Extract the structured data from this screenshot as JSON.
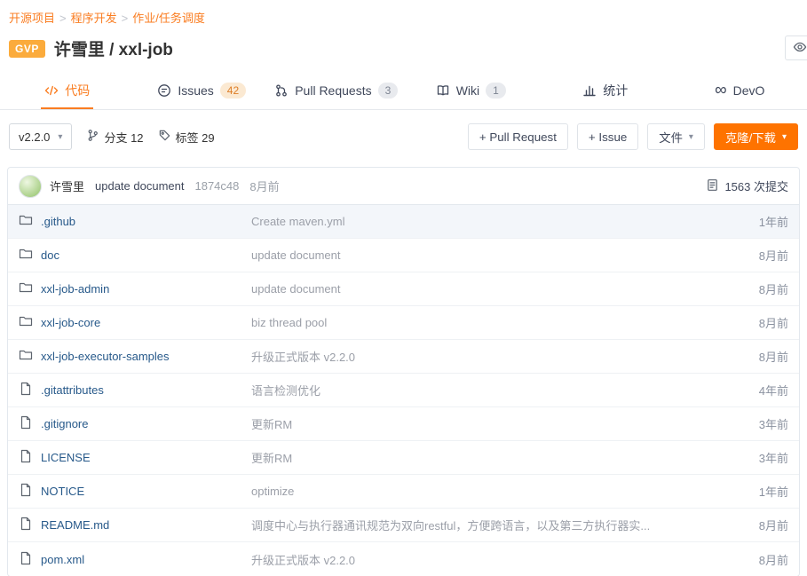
{
  "breadcrumb": {
    "separator": ">",
    "items": [
      {
        "label": "开源项目"
      },
      {
        "label": "程序开发"
      },
      {
        "label": "作业/任务调度"
      }
    ]
  },
  "header": {
    "gvp_badge": "GVP",
    "title": "许雪里 / xxl-job"
  },
  "tabs": {
    "code": {
      "label": "代码"
    },
    "issues": {
      "label": "Issues",
      "count": "42"
    },
    "pull_requests": {
      "label": "Pull Requests",
      "count": "3"
    },
    "wiki": {
      "label": "Wiki",
      "count": "1"
    },
    "stats": {
      "label": "统计"
    },
    "devops": {
      "label": "DevO"
    }
  },
  "toolbar": {
    "version_selector": "v2.2.0",
    "branches": "分支 12",
    "tags": "标签 29",
    "pull_request_button": "+ Pull Request",
    "issue_button": "+ Issue",
    "file_button": "文件",
    "clone_button": "克隆/下载"
  },
  "commit_bar": {
    "author": "许雪里",
    "message": "update document",
    "hash": "1874c48",
    "time": "8月前",
    "commits": "1563 次提交"
  },
  "files": [
    {
      "type": "folder",
      "name": ".github",
      "message": "Create maven.yml",
      "time": "1年前"
    },
    {
      "type": "folder",
      "name": "doc",
      "message": "update document",
      "time": "8月前"
    },
    {
      "type": "folder",
      "name": "xxl-job-admin",
      "message": "update document",
      "time": "8月前"
    },
    {
      "type": "folder",
      "name": "xxl-job-core",
      "message": "biz thread pool",
      "time": "8月前"
    },
    {
      "type": "folder",
      "name": "xxl-job-executor-samples",
      "message": "升级正式版本 v2.2.0",
      "time": "8月前"
    },
    {
      "type": "file",
      "name": ".gitattributes",
      "message": "语言检测优化",
      "time": "4年前"
    },
    {
      "type": "file",
      "name": ".gitignore",
      "message": "更新RM",
      "time": "3年前"
    },
    {
      "type": "file",
      "name": "LICENSE",
      "message": "更新RM",
      "time": "3年前"
    },
    {
      "type": "file",
      "name": "NOTICE",
      "message": "optimize",
      "time": "1年前"
    },
    {
      "type": "file",
      "name": "README.md",
      "message": "调度中心与执行器通讯规范为双向restful，方便跨语言，以及第三方执行器实...",
      "time": "8月前"
    },
    {
      "type": "file",
      "name": "pom.xml",
      "message": "升级正式版本 v2.2.0",
      "time": "8月前"
    }
  ],
  "icons": {
    "caret_down": "▾",
    "devops_infinity": "∞"
  },
  "colors": {
    "accent": "#fa7d21",
    "clone_button": "#fe7300",
    "gvp_badge": "#fbab3c",
    "file_link": "#27598a"
  }
}
